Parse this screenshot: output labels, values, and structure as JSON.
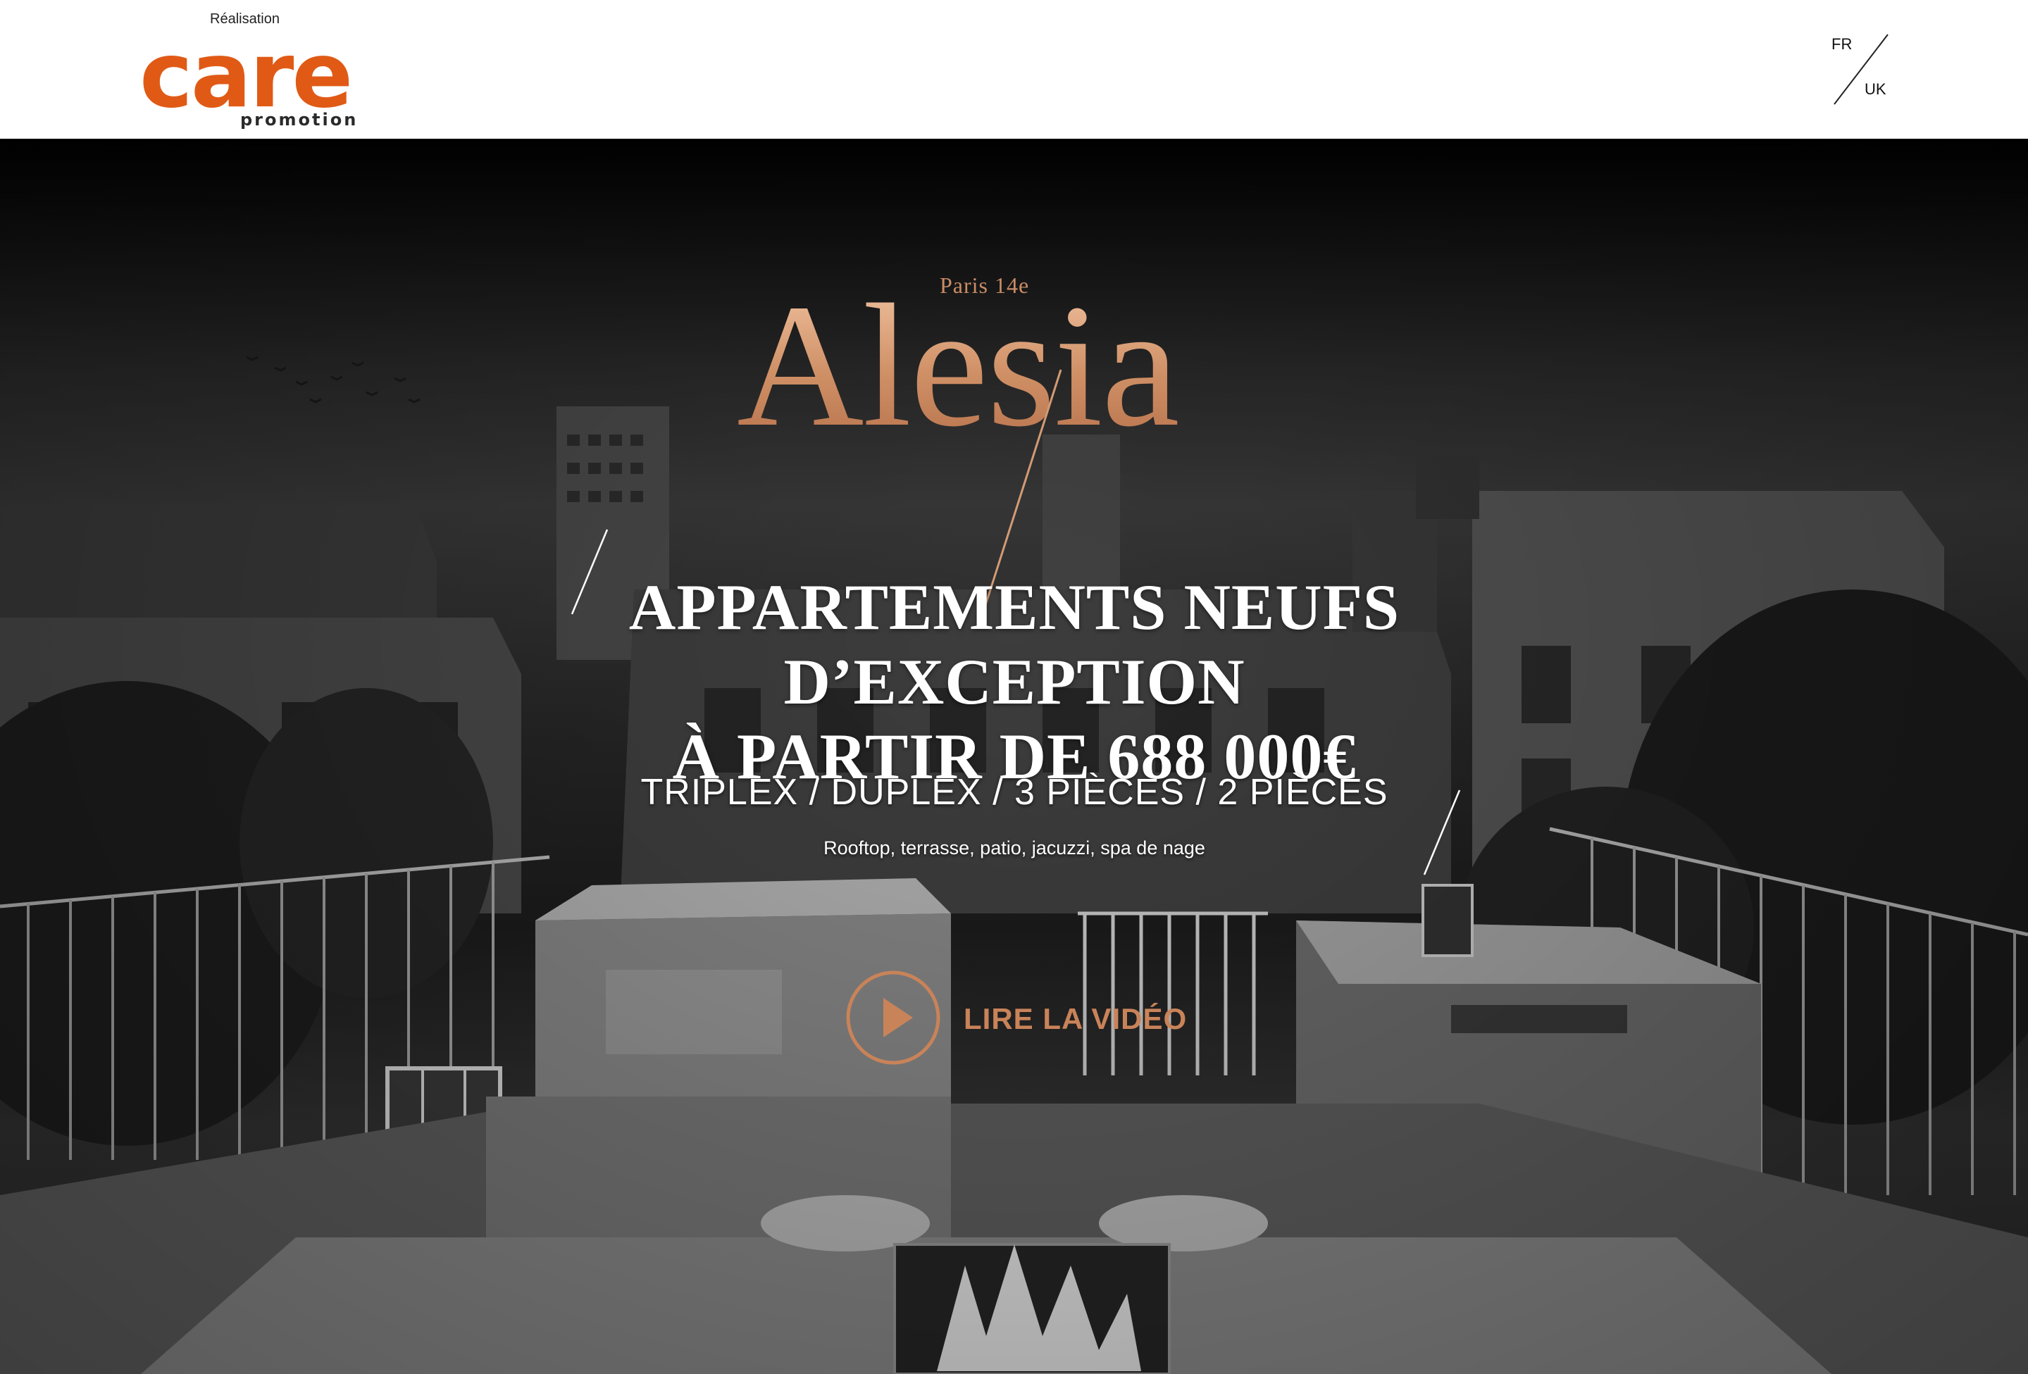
{
  "header": {
    "logo": {
      "caption": "Réalisation",
      "word": "care",
      "sub": "promotion"
    },
    "languages": [
      {
        "label": "FR"
      },
      {
        "label": "UK"
      }
    ]
  },
  "hero": {
    "city": "Paris 14e",
    "name": "Alesia",
    "headline": [
      "APPARTEMENTS NEUFS",
      "D’EXCEPTION",
      "À PARTIR DE 688 000€"
    ],
    "types": "TRIPLEX / DUPLEX / 3 PIÈCES / 2 PIÈCES",
    "amenities": "Rooftop, terrasse, patio, jacuzzi, spa de nage",
    "video": {
      "label": "LIRE LA VIDÉO",
      "icon": "play-icon"
    }
  },
  "colors": {
    "brand_orange": "#e05a16",
    "gold": "#d29b74",
    "video_accent": "#c98359"
  }
}
